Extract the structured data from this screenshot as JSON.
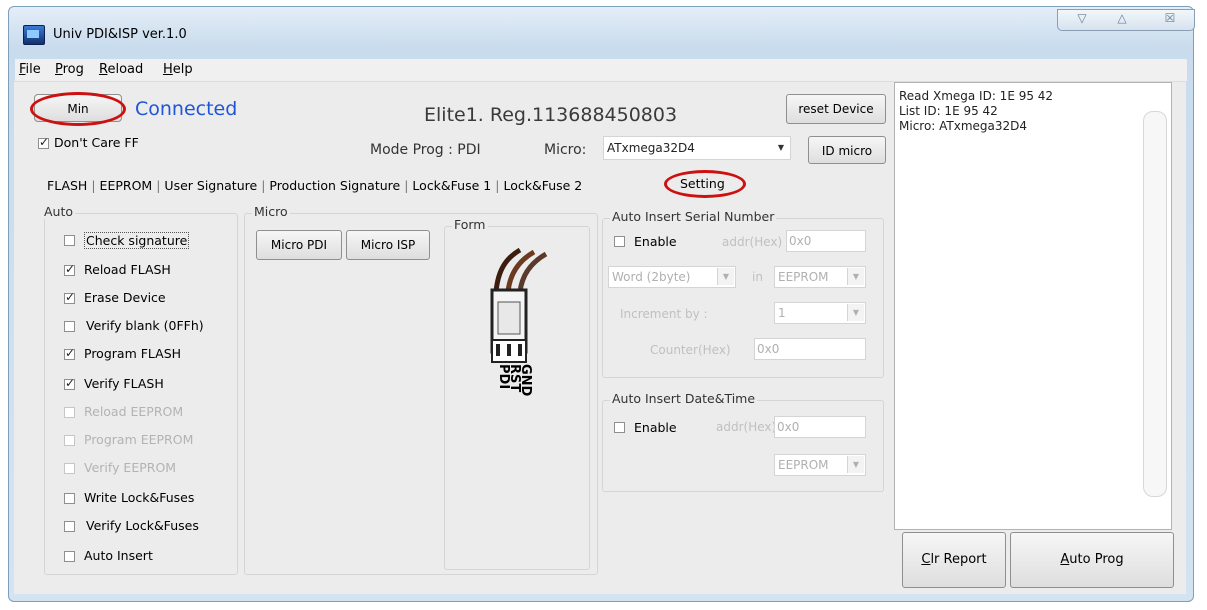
{
  "window": {
    "title": "Univ PDI&ISP  ver.1.0"
  },
  "caption": {
    "minimize": "▽",
    "maximize": "△",
    "close": "☒"
  },
  "menu": [
    {
      "key": "F",
      "rest": "ile"
    },
    {
      "key": "P",
      "rest": "rog"
    },
    {
      "key": "R",
      "rest": "eload"
    },
    {
      "key": "H",
      "rest": "elp"
    }
  ],
  "top": {
    "min_button": "Min",
    "status": "Connected",
    "device_info": "Elite1.   Reg.113688450803",
    "reset_button": "reset Device",
    "dont_care": "Don't Care FF",
    "mode": "Mode Prog : PDI",
    "micro_label": "Micro:",
    "micro_value": "ATxmega32D4",
    "id_micro_button": "ID micro"
  },
  "tabs": [
    "FLASH",
    "EEPROM",
    "User Signature",
    "Production Signature",
    "Lock&Fuse 1",
    "Lock&Fuse 2",
    "Setting"
  ],
  "auto": {
    "label": "Auto",
    "items": [
      {
        "label": "Check signature",
        "checked": false,
        "enabled": true
      },
      {
        "label": "Reload FLASH",
        "checked": true,
        "enabled": true
      },
      {
        "label": "Erase Device",
        "checked": true,
        "enabled": true
      },
      {
        "label": "Verify blank (0FFh)",
        "checked": false,
        "enabled": true
      },
      {
        "label": "Program FLASH",
        "checked": true,
        "enabled": true
      },
      {
        "label": "Verify FLASH",
        "checked": true,
        "enabled": true
      },
      {
        "label": "Reload EEPROM",
        "checked": false,
        "enabled": false
      },
      {
        "label": "Program EEPROM",
        "checked": false,
        "enabled": false
      },
      {
        "label": "Verify EEPROM",
        "checked": false,
        "enabled": false
      },
      {
        "label": "Write Lock&Fuses",
        "checked": false,
        "enabled": true
      },
      {
        "label": "Verify Lock&Fuses",
        "checked": false,
        "enabled": true
      },
      {
        "label": "Auto Insert",
        "checked": false,
        "enabled": true
      }
    ]
  },
  "micro": {
    "label": "Micro",
    "pdi_button": "Micro PDI",
    "isp_button": "Micro ISP"
  },
  "form": {
    "label": "Form",
    "pins": [
      "PDI",
      "RST",
      "GND"
    ]
  },
  "serial": {
    "label": "Auto Insert Serial Number",
    "enable": "Enable",
    "addr_label": "addr(Hex)",
    "addr_value": "0x0",
    "word_select": "Word (2byte)",
    "in_label": "in",
    "mem_select": "EEPROM",
    "increment_label": "Increment by :",
    "increment_value": "1",
    "counter_label": "Counter(Hex)",
    "counter_value": "0x0"
  },
  "datetime": {
    "label": "Auto Insert Date&Time",
    "enable": "Enable",
    "addr_label": "addr(Hex)",
    "addr_value": "0x0",
    "mem_select": "EEPROM"
  },
  "report": {
    "lines": [
      "Read Xmega ID: 1E 95 42",
      "List ID: 1E 95 42",
      "Micro: ATxmega32D4"
    ]
  },
  "bottom": {
    "clr_key": "C",
    "clr_rest": "lr Report",
    "auto_key": "A",
    "auto_rest": "uto Prog"
  },
  "colors": {
    "status": "#1f55d8",
    "highlight_circle": "#cc1111"
  }
}
